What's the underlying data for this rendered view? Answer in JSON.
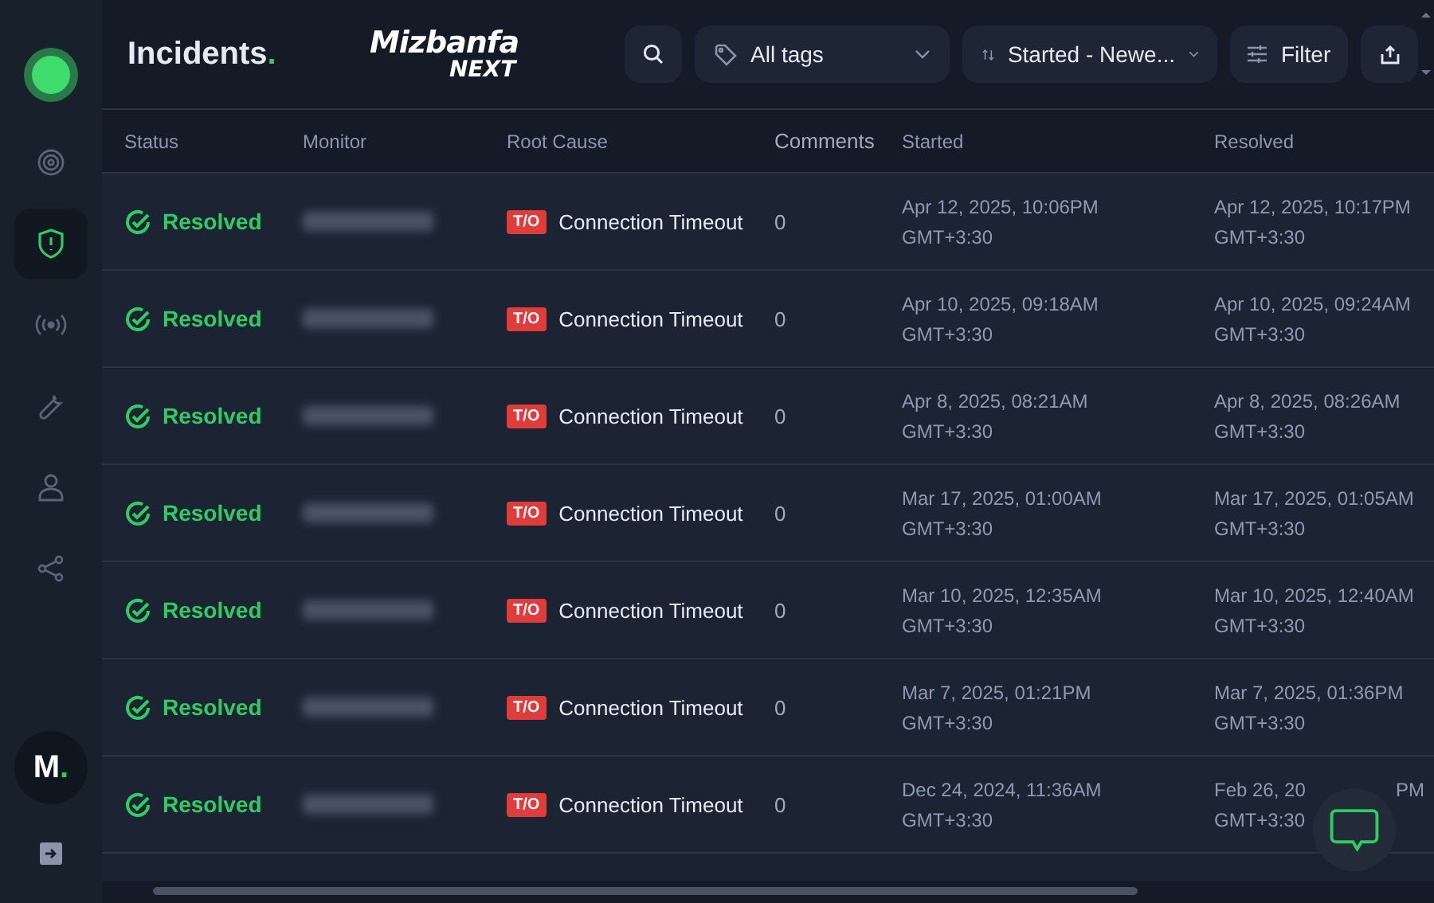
{
  "header": {
    "title": "Incidents",
    "title_dot": ".",
    "logo_word": "Mizbanfa",
    "logo_sub": "NEXT",
    "tags": {
      "value": "All tags"
    },
    "sort": {
      "value": "Started - Newe..."
    },
    "filter_label": "Filter"
  },
  "sidebar": {
    "items": [
      {
        "kind": "target",
        "selected": false
      },
      {
        "kind": "shield",
        "selected": true
      },
      {
        "kind": "signal",
        "selected": false
      },
      {
        "kind": "wrench",
        "selected": false
      },
      {
        "kind": "user",
        "selected": false
      },
      {
        "kind": "share",
        "selected": false
      }
    ],
    "avatar": "M",
    "avatar_dot": "."
  },
  "table": {
    "columns": [
      "Status",
      "Monitor",
      "Root Cause",
      "Comments",
      "Started",
      "Resolved"
    ],
    "rows": [
      {
        "status": "Resolved",
        "tag": "T/O",
        "cause": "Connection Timeout",
        "comments": "0",
        "started": [
          "Apr 12, 2025, 10:06PM",
          "GMT+3:30"
        ],
        "resolved": [
          "Apr 12, 2025, 10:17PM",
          "GMT+3:30"
        ]
      },
      {
        "status": "Resolved",
        "tag": "T/O",
        "cause": "Connection Timeout",
        "comments": "0",
        "started": [
          "Apr 10, 2025, 09:18AM",
          "GMT+3:30"
        ],
        "resolved": [
          "Apr 10, 2025, 09:24AM",
          "GMT+3:30"
        ]
      },
      {
        "status": "Resolved",
        "tag": "T/O",
        "cause": "Connection Timeout",
        "comments": "0",
        "started": [
          "Apr 8, 2025, 08:21AM",
          "GMT+3:30"
        ],
        "resolved": [
          "Apr 8, 2025, 08:26AM",
          "GMT+3:30"
        ]
      },
      {
        "status": "Resolved",
        "tag": "T/O",
        "cause": "Connection Timeout",
        "comments": "0",
        "started": [
          "Mar 17, 2025, 01:00AM",
          "GMT+3:30"
        ],
        "resolved": [
          "Mar 17, 2025, 01:05AM",
          "GMT+3:30"
        ]
      },
      {
        "status": "Resolved",
        "tag": "T/O",
        "cause": "Connection Timeout",
        "comments": "0",
        "started": [
          "Mar 10, 2025, 12:35AM",
          "GMT+3:30"
        ],
        "resolved": [
          "Mar 10, 2025, 12:40AM",
          "GMT+3:30"
        ]
      },
      {
        "status": "Resolved",
        "tag": "T/O",
        "cause": "Connection Timeout",
        "comments": "0",
        "started": [
          "Mar 7, 2025, 01:21PM",
          "GMT+3:30"
        ],
        "resolved": [
          "Mar 7, 2025, 01:36PM",
          "GMT+3:30"
        ]
      },
      {
        "status": "Resolved",
        "tag": "T/O",
        "cause": "Connection Timeout",
        "comments": "0",
        "started": [
          "Dec 24, 2024, 11:36AM",
          "GMT+3:30"
        ],
        "resolved": [
          "Feb 26, 20",
          "GMT+3:30"
        ],
        "resolved_end": "PM"
      }
    ]
  }
}
